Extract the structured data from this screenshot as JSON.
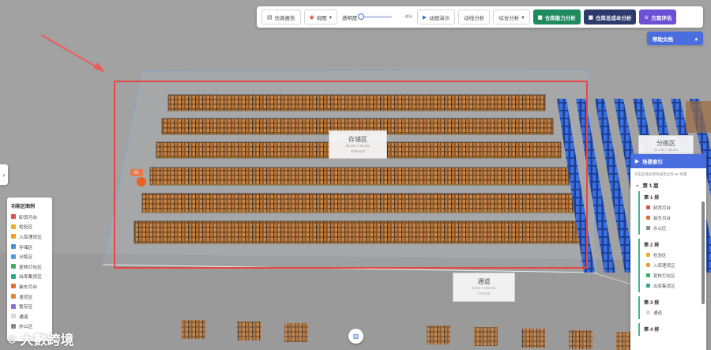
{
  "toolbar": {
    "report": "仿真报告",
    "view": "视图",
    "opacity_label": "透明度",
    "opacity_value": "4%",
    "opacity_level": 0.04,
    "animation": "动画演示",
    "flow": "动线分析",
    "analysis": "综合分析",
    "capacity": "仓库能力分析",
    "cost": "仓库总成本分析",
    "evaluate": "方案评估",
    "capacity_color": "#1f8a5f",
    "cost_color": "#2e3a6b",
    "evaluate_color": "#6b50d6"
  },
  "help": {
    "label": "帮助文档",
    "color": "#4a6ee0"
  },
  "legend": {
    "title": "功能区图例",
    "items": [
      {
        "label": "卸货月台",
        "color": "#d9534f"
      },
      {
        "label": "检验区",
        "color": "#e8b02b"
      },
      {
        "label": "入库理货区",
        "color": "#f0a030"
      },
      {
        "label": "存储区",
        "color": "#4a90d9"
      },
      {
        "label": "分拣区",
        "color": "#4aa0e0"
      },
      {
        "label": "复核打包区",
        "color": "#3fae6a"
      },
      {
        "label": "出库集货区",
        "color": "#2fa88f"
      },
      {
        "label": "装车月台",
        "color": "#e07030"
      },
      {
        "label": "退货区",
        "color": "#e8832f"
      },
      {
        "label": "暂存区",
        "color": "#8a6fd0"
      },
      {
        "label": "通道",
        "color": "#d8d8d8"
      },
      {
        "label": "办公区",
        "color": "#8a8a8a"
      }
    ]
  },
  "scene_index": {
    "title": "场景索引",
    "hint": "点击区域名称快速定位到 3D 场景",
    "floor": "第 1 层",
    "groups": [
      {
        "title": "第 1 排",
        "items": [
          {
            "label": "卸货月台",
            "color": "#d9534f"
          },
          {
            "label": "装车月台",
            "color": "#e07030"
          },
          {
            "label": "办公区",
            "color": "#8a8a8a"
          }
        ]
      },
      {
        "title": "第 2 排",
        "items": [
          {
            "label": "检验区",
            "color": "#e8b02b"
          },
          {
            "label": "入库理货区",
            "color": "#f0a030"
          },
          {
            "label": "复核打包区",
            "color": "#3fae6a"
          },
          {
            "label": "出库集货区",
            "color": "#2fa88f"
          }
        ]
      },
      {
        "title": "第 3 排",
        "items": [
          {
            "label": "通道",
            "color": "#d8d8d8"
          }
        ]
      },
      {
        "title": "第 4 排",
        "items": []
      }
    ]
  },
  "zones": {
    "storage": {
      "title": "存储区",
      "dim": "95.0m × 60.0m",
      "area": "5700.0㎡"
    },
    "sorting": {
      "title": "分拣区",
      "dim": "12.0m × 45.0m",
      "area": ""
    },
    "aisle": {
      "title": "通道",
      "dim": "6.0m × 120.0m",
      "area": "720.0㎡"
    }
  },
  "marker": "B1",
  "watermark": "大數跨境",
  "colors": {
    "highlight": "#e84545",
    "shelf": "#b06a2e",
    "blue_rack": "#2a5fd0"
  }
}
